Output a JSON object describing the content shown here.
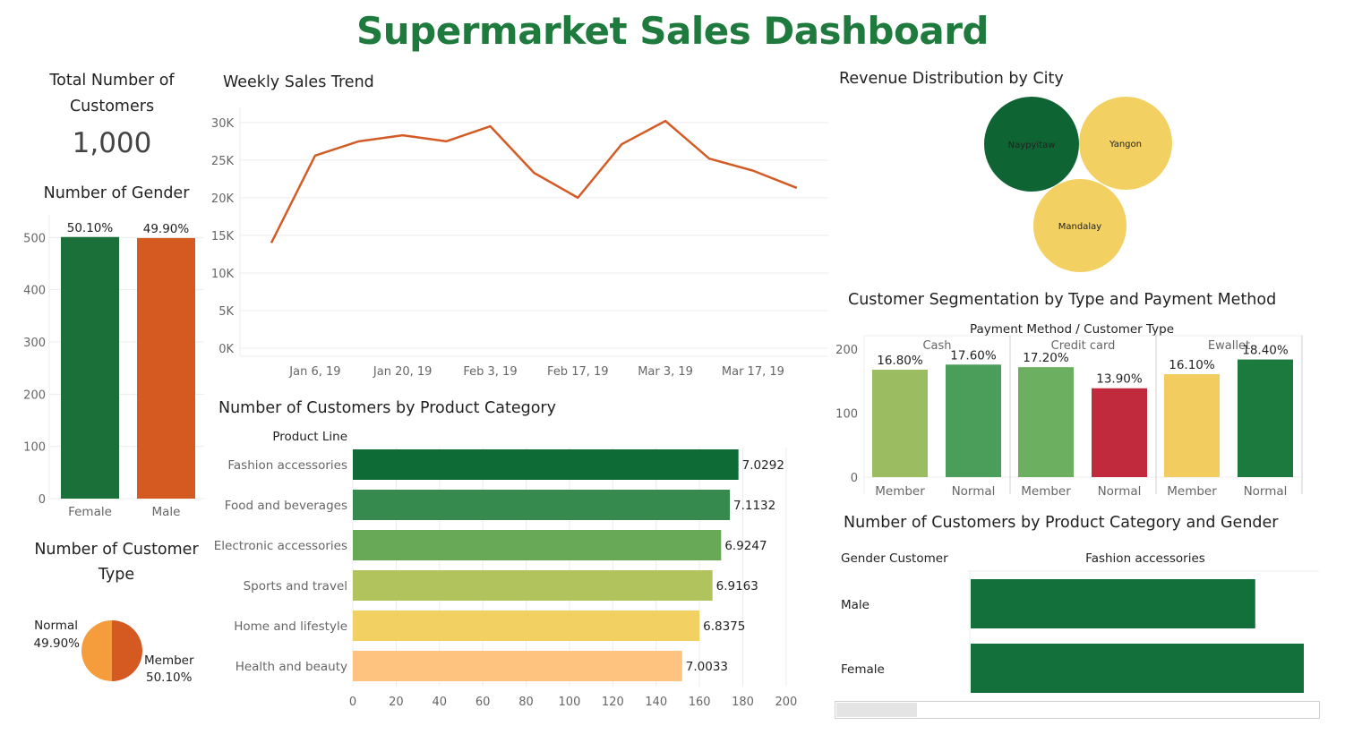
{
  "dashboard_title": "Supermarket Sales Dashboard",
  "kpi": {
    "label": "Total Number of Customers",
    "value": "1,000"
  },
  "colors": {
    "dark_green": "#1b7039",
    "orange": "#d45a21",
    "line": "#d35c26",
    "light_orange": "#f59d3d"
  },
  "chart_data": [
    {
      "id": "gender",
      "type": "bar",
      "title": "Number of Gender",
      "categories": [
        "Female",
        "Male"
      ],
      "values": [
        501,
        499
      ],
      "data_labels": [
        "50.10%",
        "49.90%"
      ],
      "colors": [
        "#1b7039",
        "#d45a21"
      ],
      "ylim": [
        0,
        540
      ],
      "yticks": [
        0,
        100,
        200,
        300,
        400,
        500
      ]
    },
    {
      "id": "weekly",
      "type": "line",
      "title": "Weekly Sales Trend",
      "x": [
        "2018-12-30",
        "2019-01-06",
        "2019-01-13",
        "2019-01-20",
        "2019-01-27",
        "2019-02-03",
        "2019-02-10",
        "2019-02-17",
        "2019-02-24",
        "2019-03-03",
        "2019-03-10",
        "2019-03-17",
        "2019-03-24"
      ],
      "values": [
        14000,
        25600,
        27500,
        28300,
        27500,
        29500,
        23300,
        20000,
        27100,
        30200,
        25200,
        23600,
        21300
      ],
      "xtick_labels": [
        "Jan 6, 19",
        "Jan 20, 19",
        "Feb 3, 19",
        "Feb 17, 19",
        "Mar 3, 19",
        "Mar 17, 19"
      ],
      "xtick_index": [
        1,
        3,
        5,
        7,
        9,
        11
      ],
      "ytick_labels": [
        "0K",
        "5K",
        "10K",
        "15K",
        "20K",
        "25K",
        "30K"
      ],
      "yticks": [
        0,
        5000,
        10000,
        15000,
        20000,
        25000,
        30000
      ],
      "ylim": [
        0,
        32000
      ]
    },
    {
      "id": "city",
      "type": "bubble",
      "title": "Revenue Distribution by City",
      "categories": [
        "Naypyitaw",
        "Yangon",
        "Mandalay"
      ],
      "colors": [
        "#0f6434",
        "#f2d062",
        "#f2d062"
      ]
    },
    {
      "id": "segmentation",
      "type": "bar",
      "title": "Customer Segmentation by Type and Payment Method",
      "header": "Payment Method  /  Customer Type",
      "groups": [
        "Cash",
        "Credit card",
        "Ewallet"
      ],
      "categories": [
        "Member",
        "Normal"
      ],
      "values": [
        [
          168,
          176
        ],
        [
          172,
          139
        ],
        [
          161,
          184
        ]
      ],
      "data_labels": [
        [
          "16.80%",
          "17.60%"
        ],
        [
          "17.20%",
          "13.90%"
        ],
        [
          "16.10%",
          "18.40%"
        ]
      ],
      "colors": [
        [
          "#9bbc61",
          "#4a9e59"
        ],
        [
          "#6daf61",
          "#c12a3d"
        ],
        [
          "#f2cc5f",
          "#1d7a3e"
        ]
      ],
      "ylim": [
        0,
        210
      ],
      "yticks": [
        0,
        100,
        200
      ]
    },
    {
      "id": "category",
      "type": "bar",
      "orientation": "horizontal",
      "title": "Number of Customers by Product Category",
      "axis_header": "Product Line",
      "categories": [
        "Fashion accessories",
        "Food and beverages",
        "Electronic accessories",
        "Sports and travel",
        "Home and lifestyle",
        "Health and beauty"
      ],
      "values": [
        178,
        174,
        170,
        166,
        160,
        152
      ],
      "data_labels": [
        "7.0292",
        "7.1132",
        "6.9247",
        "6.9163",
        "6.8375",
        "7.0033"
      ],
      "colors": [
        "#0f6b36",
        "#368a4d",
        "#67a957",
        "#b0c35c",
        "#f2d062",
        "#fec37f"
      ],
      "xlim": [
        0,
        205
      ],
      "xticks": [
        0,
        20,
        40,
        60,
        80,
        100,
        120,
        140,
        160,
        180,
        200
      ]
    },
    {
      "id": "category_gender",
      "type": "bar",
      "orientation": "horizontal",
      "title": "Number of Customers by Product Category and Gender",
      "row_header": "Gender Customer",
      "column_header": "Fashion accessories",
      "categories": [
        "Male",
        "Female"
      ],
      "values": [
        82,
        96
      ],
      "colors": [
        "#13703a",
        "#13703a"
      ],
      "xlim": [
        0,
        96
      ]
    },
    {
      "id": "customer_type",
      "type": "pie",
      "title": "Number of Customer Type",
      "categories": [
        "Normal",
        "Member"
      ],
      "values": [
        49.9,
        50.1
      ],
      "data_labels": [
        "49.90%",
        "50.10%"
      ],
      "colors": [
        "#f59d3d",
        "#d45a21"
      ]
    }
  ]
}
